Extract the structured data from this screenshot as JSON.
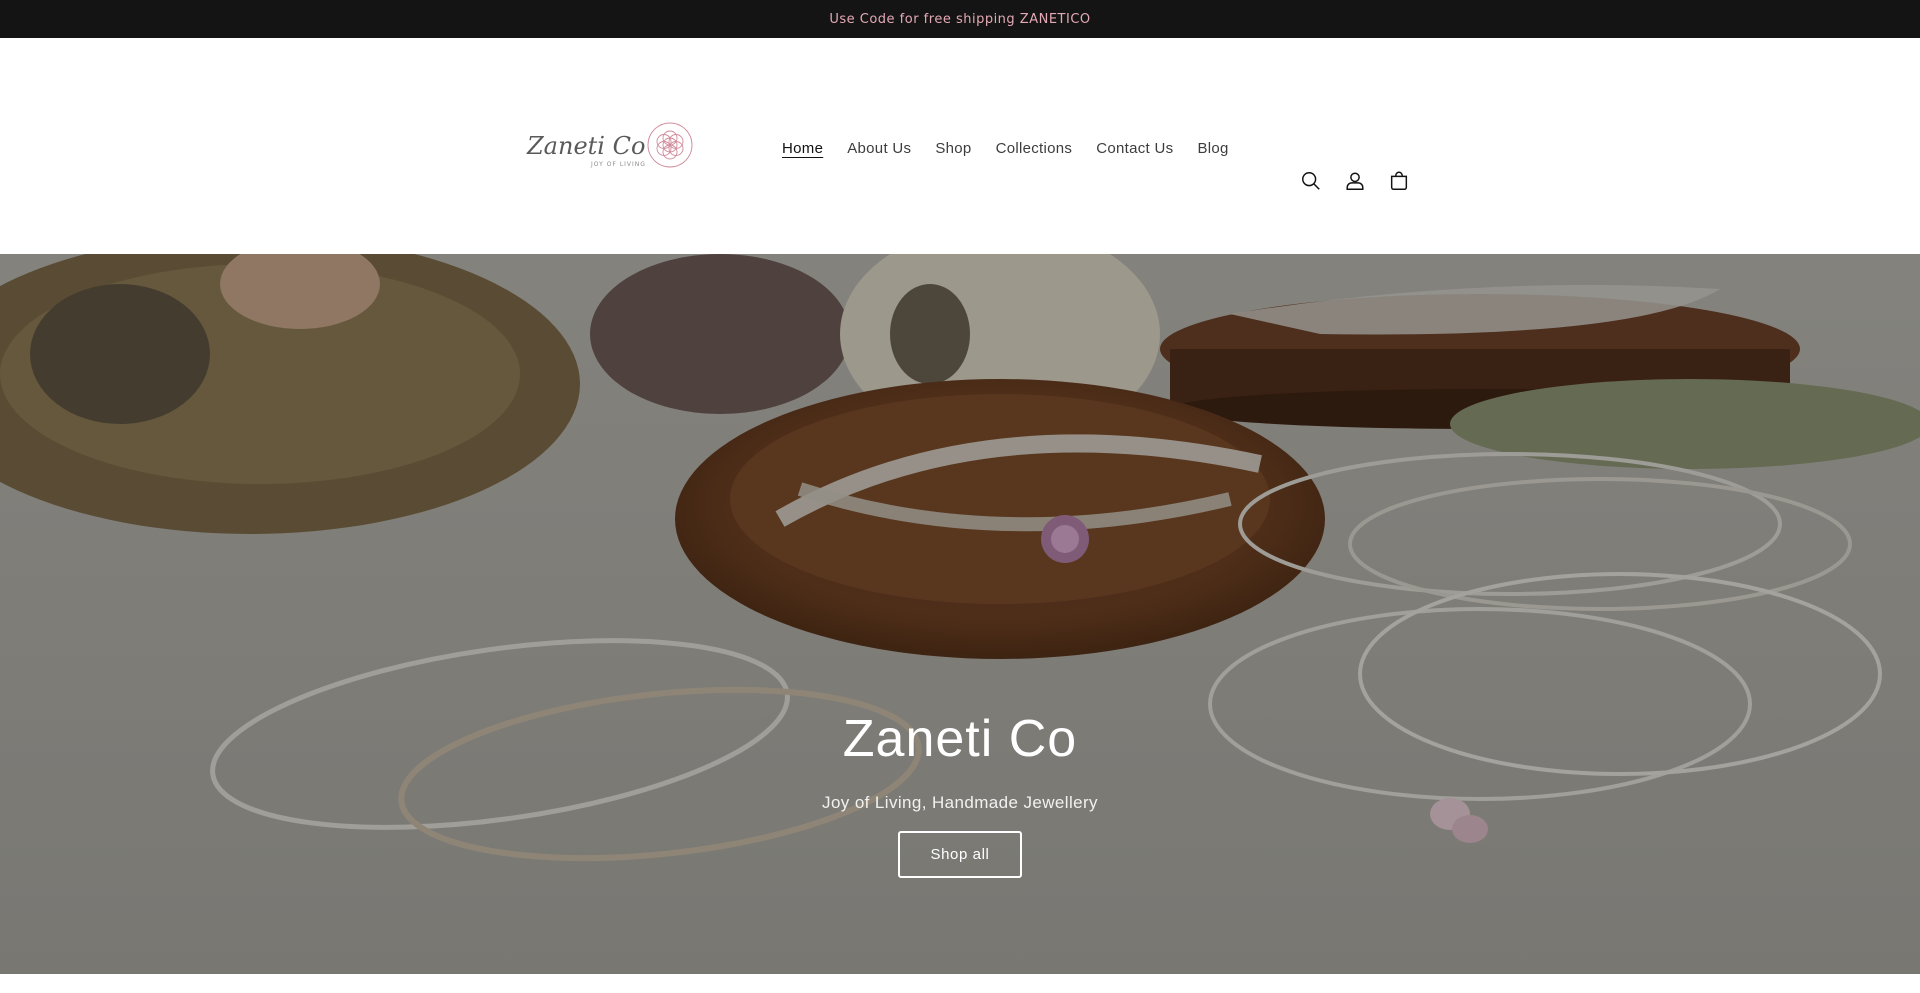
{
  "announcement": {
    "text": "Use Code for free shipping ZANETICO"
  },
  "header": {
    "logo": {
      "script_text": "Zaneti Co",
      "tagline": "JOY OF LIVING"
    },
    "nav": [
      {
        "label": "Home",
        "active": true
      },
      {
        "label": "About Us",
        "active": false
      },
      {
        "label": "Shop",
        "active": false
      },
      {
        "label": "Collections",
        "active": false
      },
      {
        "label": "Contact Us",
        "active": false
      },
      {
        "label": "Blog",
        "active": false
      }
    ],
    "icons": [
      "search-icon",
      "account-icon",
      "cart-icon"
    ]
  },
  "hero": {
    "title": "Zaneti Co",
    "subtitle": "Joy of Living, Handmade Jewellery",
    "button_label": "Shop all"
  },
  "colors": {
    "announcement_bg": "#141414",
    "announcement_text": "#e3a9b4",
    "brand_accent": "#c98a9a"
  }
}
